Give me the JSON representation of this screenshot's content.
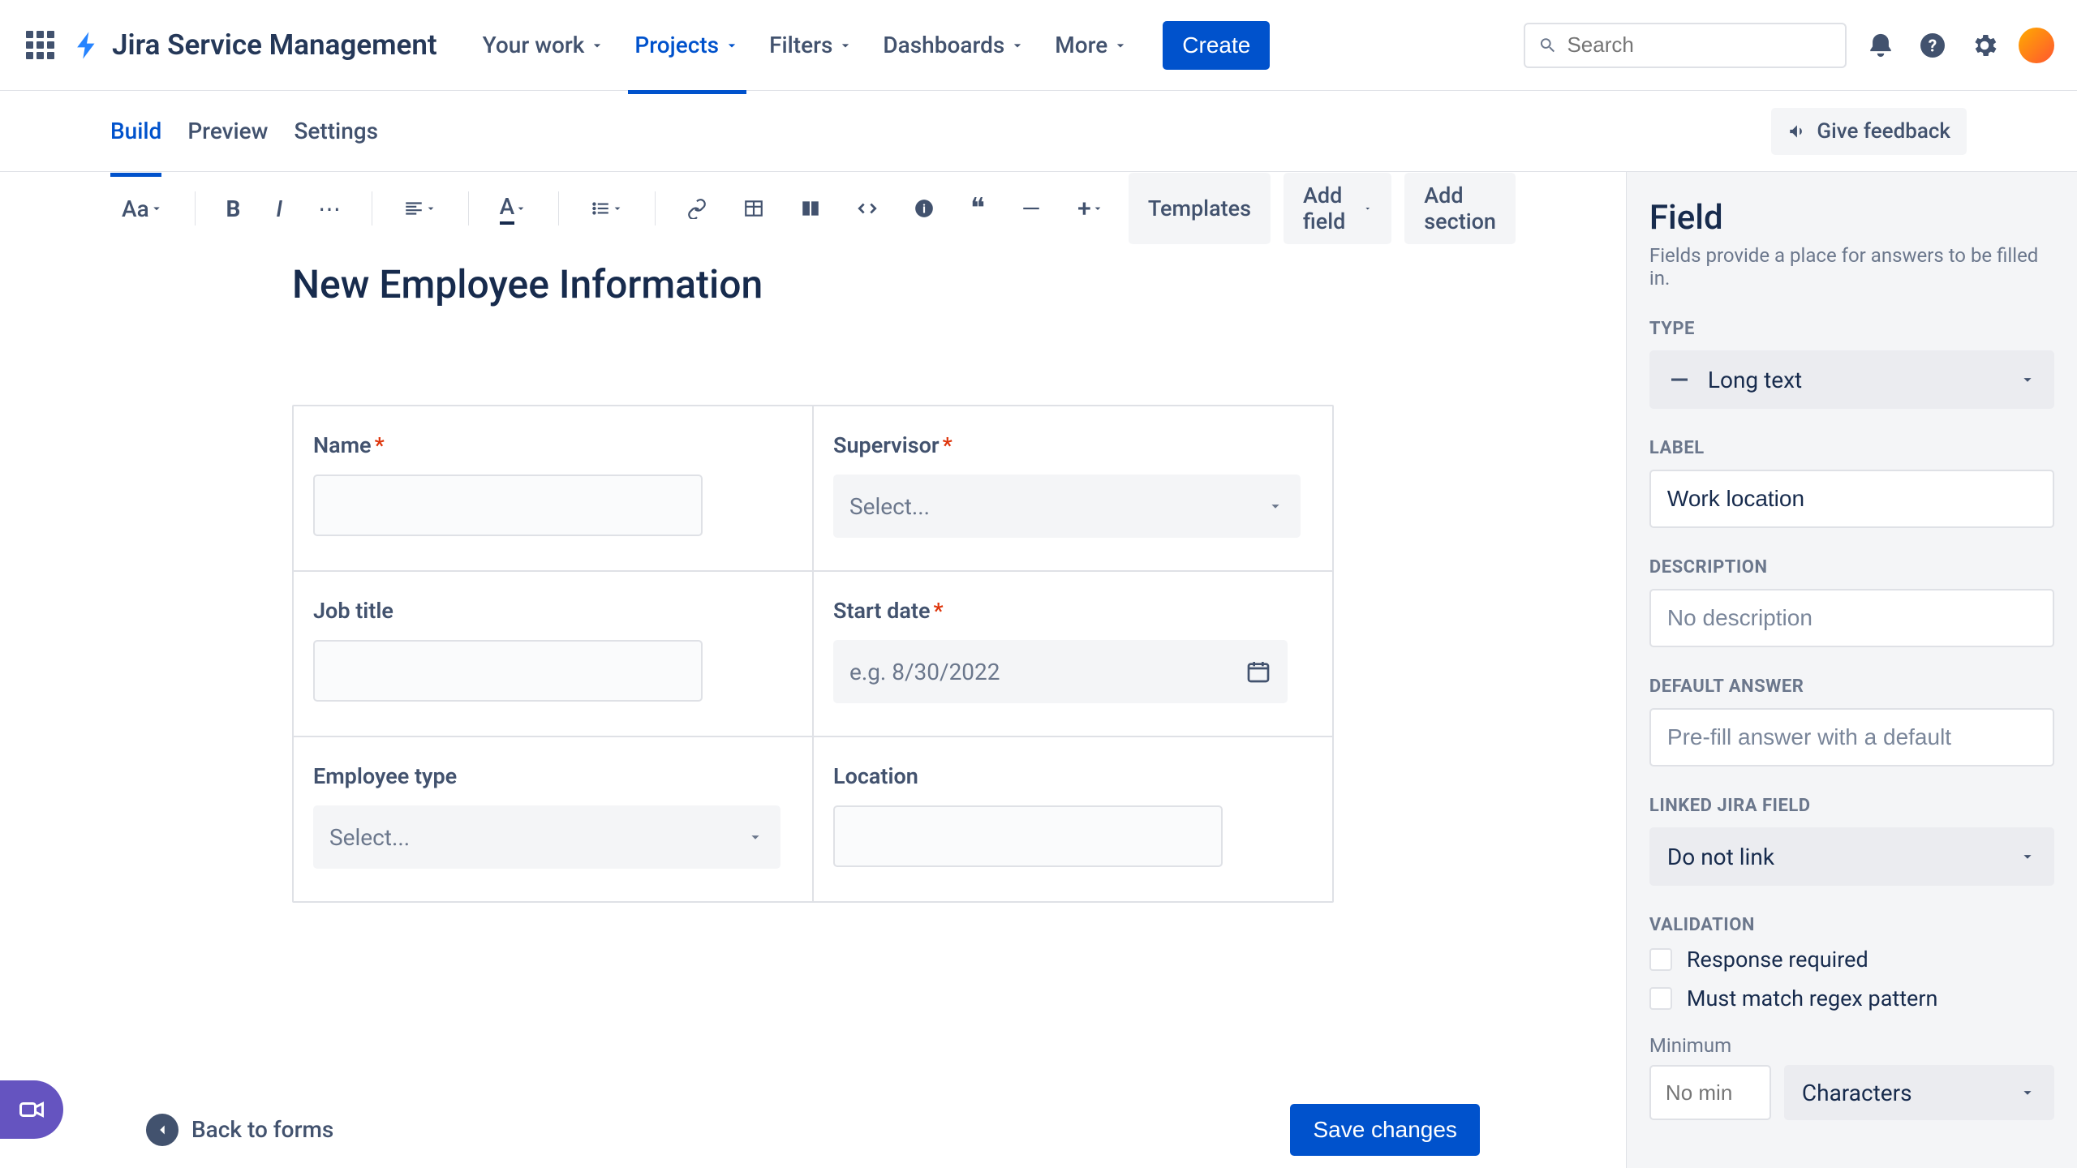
{
  "app": {
    "name": "Jira Service Management"
  },
  "nav": {
    "items": [
      {
        "label": "Your work"
      },
      {
        "label": "Projects"
      },
      {
        "label": "Filters"
      },
      {
        "label": "Dashboards"
      },
      {
        "label": "More"
      }
    ],
    "create": "Create",
    "search_placeholder": "Search"
  },
  "tabs": {
    "items": [
      {
        "label": "Build"
      },
      {
        "label": "Preview"
      },
      {
        "label": "Settings"
      }
    ],
    "feedback": "Give feedback"
  },
  "toolbar": {
    "text_style": "Aa",
    "templates": "Templates",
    "add_field": "Add field",
    "add_section": "Add section"
  },
  "form": {
    "title": "New Employee Information",
    "fields": {
      "name": {
        "label": "Name"
      },
      "supervisor": {
        "label": "Supervisor",
        "placeholder": "Select..."
      },
      "job_title": {
        "label": "Job title"
      },
      "start_date": {
        "label": "Start date",
        "placeholder": "e.g. 8/30/2022"
      },
      "employee_type": {
        "label": "Employee type",
        "placeholder": "Select..."
      },
      "location": {
        "label": "Location"
      }
    }
  },
  "footer": {
    "back": "Back to forms",
    "save": "Save changes"
  },
  "sidebar": {
    "title": "Field",
    "subtitle": "Fields provide a place for answers to be filled in.",
    "type": {
      "label": "TYPE",
      "value": "Long text"
    },
    "label_section": {
      "label": "LABEL",
      "value": "Work location"
    },
    "description": {
      "label": "DESCRIPTION",
      "placeholder": "No description"
    },
    "default_answer": {
      "label": "DEFAULT ANSWER",
      "placeholder": "Pre-fill answer with a default"
    },
    "linked": {
      "label": "LINKED JIRA FIELD",
      "value": "Do not link"
    },
    "validation": {
      "label": "VALIDATION",
      "response_required": "Response required",
      "regex": "Must match regex pattern",
      "minimum_label": "Minimum",
      "min_placeholder": "No min",
      "unit": "Characters"
    }
  }
}
